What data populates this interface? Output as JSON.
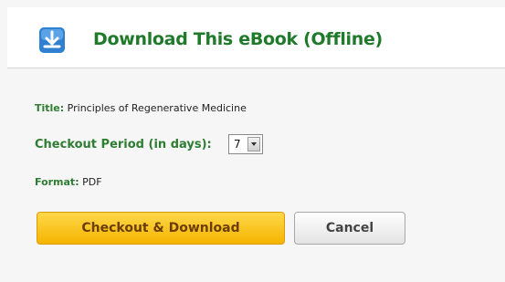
{
  "header": {
    "title": "Download This eBook (Offline)",
    "icon": "download-icon",
    "icon_color": "#2f80d1"
  },
  "details": {
    "title_label": "Title:",
    "title_value": "Principles of Regenerative Medicine",
    "period_label": "Checkout Period (in days):",
    "period_value": "7",
    "format_label": "Format:",
    "format_value": "PDF"
  },
  "buttons": {
    "checkout_label": "Checkout & Download",
    "cancel_label": "Cancel"
  },
  "colors": {
    "accent_green": "#2e7d32",
    "primary_button": "#f4b400"
  }
}
